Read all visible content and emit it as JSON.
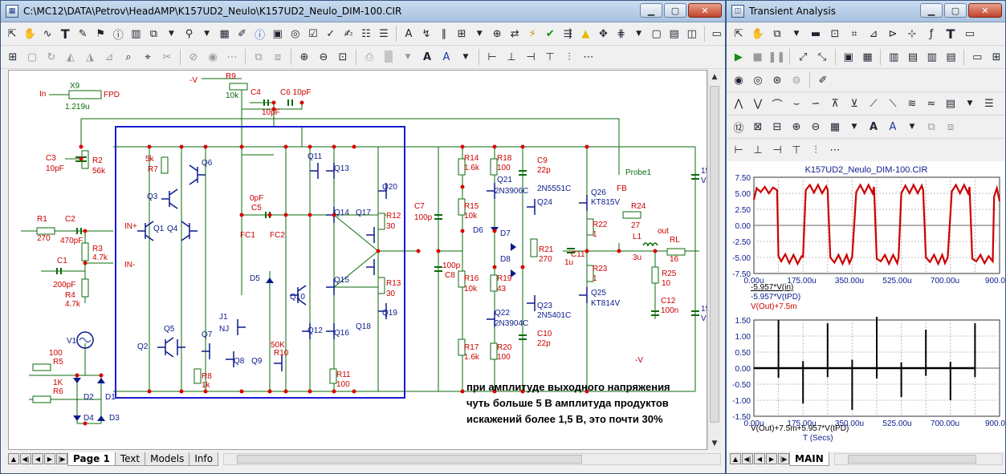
{
  "main_window": {
    "title": "C:\\MC12\\DATA\\Petrov\\HeadAMP\\K157UD2_Neulo\\K157UD2_Neulo_DIM-100.CIR",
    "tabs": [
      "Page 1",
      "Text",
      "Models",
      "Info"
    ]
  },
  "ta_window": {
    "title": "Transient Analysis",
    "tabs": [
      "MAIN"
    ]
  },
  "schematic": {
    "components": {
      "X9": "X9",
      "X9_value": "1.219u",
      "in_label": "In",
      "fpd": "FPD",
      "R9": "R9",
      "R9_value": "10k",
      "vneg": "-V",
      "C4": "C4",
      "C6": "C6 10pF",
      "C4_value": "10pF",
      "C3": "C3",
      "C3_value": "10pF",
      "R2": "R2",
      "R2_value": "56k",
      "R7_value": "5k",
      "R7": "R7",
      "Q6": "Q6",
      "Q3": "Q3",
      "R1": "R1",
      "R1_value": "270",
      "C2": "C2",
      "C2_value": "470pF",
      "INp": "IN+",
      "INm": "IN-",
      "Q1": "Q1",
      "Q4": "Q4",
      "R3": "R3",
      "R3_value": "4.7k",
      "C1": "C1",
      "C1_value": "200pF",
      "R4": "R4",
      "R4_value": "4.7k",
      "V1": "V1",
      "R5_value": "100",
      "R5": "R5",
      "R6_value": "1K",
      "R6": "R6",
      "D2": "D2",
      "D1": "D1",
      "D4": "D4",
      "D3": "D3",
      "Q5": "Q5",
      "Q2": "Q2",
      "Q7": "Q7",
      "Q8": "Q8",
      "R8": "R8",
      "R8_value": "1k",
      "C5_value": "0pF",
      "C5": "C5",
      "FC1": "FC1",
      "FC2": "FC2",
      "D5": "D5",
      "J1": "J1",
      "NJ": "NJ",
      "Q9": "Q9",
      "R10_value": "50K",
      "R10": "R10",
      "Q10": "Q10",
      "Q11": "Q11",
      "Q13": "Q13",
      "Q14": "Q14",
      "Q15": "Q15",
      "Q12": "Q12",
      "Q16": "Q16",
      "R11": "R11",
      "R11_value": "100",
      "Q17": "Q17",
      "Q20": "Q20",
      "R12": "R12",
      "R12_value": "30",
      "R13": "R13",
      "R13_value": "30",
      "Q18": "Q18",
      "Q19": "Q19",
      "R14": "R14",
      "R14_value": "1.6k",
      "R18": "R18",
      "R18_value": "100",
      "C9": "C9",
      "C9_value": "22p",
      "Q21": "Q21",
      "Q21_type": "2N3906C",
      "Q24": "Q24",
      "Q24_type": "2N5551C",
      "Q26": "Q26",
      "Q26_type": "KT815V",
      "probe": "Probe1",
      "FB": "FB",
      "C7": "C7",
      "C7_value": "100p",
      "R15": "R15",
      "R15_value": "10k",
      "D6": "D6",
      "D7": "D7",
      "D8": "D8",
      "R21": "R21",
      "R21_value": "270",
      "C11": "C11",
      "C11_value": "1u",
      "R22": "R22",
      "R22_value": "1",
      "R24": "R24",
      "R24_value": "27",
      "L1": "L1",
      "L1_value": "3u",
      "out": "out",
      "RL": "RL",
      "RL_value": "16",
      "C8_value": "100p",
      "C8": "C8",
      "R16": "R16",
      "R16_value": "10k",
      "R19": "R19",
      "R19_value": "43",
      "R23": "R23",
      "R23_value": "1",
      "R25": "R25",
      "R25_value": "10",
      "Q25": "Q25",
      "Q25_type": "KT814V",
      "Q22": "Q22",
      "Q22_type": "2N3904C",
      "Q23": "Q23",
      "Q23_type": "2N5401C",
      "C12": "C12",
      "C12_value": "100n",
      "R17": "R17",
      "R17_value": "1.6k",
      "R20": "R20",
      "R20_value": "100",
      "C10": "C10",
      "C10_value": "22p",
      "vneg2": "-V",
      "V2": "15",
      "V2_name": "V2",
      "V3": "15",
      "V3_name": "V3"
    },
    "annotation": [
      "при амплитуде выходного напряжения",
      "чуть больше 5 В амплитуда продуктов",
      "искажений более 1,5 В, это почти 30%"
    ]
  },
  "chart_data": [
    {
      "type": "line",
      "title": "K157UD2_Neulo_DIM-100.CIR",
      "x_ticks": [
        "0.00u",
        "175.00u",
        "350.00u",
        "525.00u",
        "700.00u",
        "900.00u"
      ],
      "y_ticks": [
        "7.50",
        "5.00",
        "2.50",
        "0.00",
        "-2.50",
        "-5.00",
        "-7.50"
      ],
      "ylim": [
        -7.5,
        7.5
      ],
      "xlim": [
        0,
        900
      ],
      "legend": [
        "-5.957*V(in)",
        "-5.957*V(tPD)",
        "V(Out)+7.5m"
      ],
      "series": [
        {
          "name": "V(Out)+7.5m",
          "color": "#cc0000",
          "x": [
            0,
            10,
            25,
            40,
            55,
            70,
            85,
            90,
            100,
            115,
            130,
            145,
            160,
            175,
            180,
            190,
            205,
            220,
            235,
            250,
            265,
            270,
            280,
            295,
            310,
            325,
            340,
            350,
            360,
            375,
            390,
            405,
            420,
            435,
            440,
            450,
            465,
            480,
            495,
            510,
            525,
            530,
            540,
            555,
            570,
            585,
            600,
            615,
            620,
            630,
            645,
            660,
            675,
            690,
            700,
            710,
            725,
            740,
            755,
            770,
            785,
            790,
            800,
            815,
            830,
            845,
            860,
            875,
            880,
            890,
            900
          ],
          "y": [
            4.0,
            5.8,
            5.2,
            6.0,
            5.0,
            5.9,
            5.5,
            -4.8,
            -5.6,
            -4.5,
            -5.9,
            -4.6,
            -6.0,
            -4.8,
            -4.9,
            5.5,
            6.3,
            5.1,
            6.3,
            5.0,
            6.1,
            5.6,
            -5.0,
            -5.8,
            -4.6,
            -6.0,
            -4.6,
            -5.9,
            -4.9,
            5.2,
            6.3,
            5.0,
            6.3,
            5.0,
            6.0,
            -5.2,
            -5.6,
            -4.6,
            -6.0,
            -4.6,
            -5.9,
            -5.0,
            5.0,
            6.2,
            5.0,
            6.3,
            5.0,
            6.2,
            5.5,
            -5.0,
            -5.7,
            -4.6,
            -6.0,
            -4.6,
            -5.9,
            -5.0,
            5.3,
            6.3,
            5.0,
            6.3,
            5.0,
            6.0,
            -5.2,
            -5.6,
            -4.6,
            -5.9,
            -4.8,
            -5.6,
            4.5,
            5.8,
            3.8
          ]
        }
      ]
    },
    {
      "type": "line",
      "x_ticks": [
        "0.00u",
        "175.00u",
        "350.00u",
        "525.00u",
        "700.00u",
        "900.00u"
      ],
      "y_ticks": [
        "1.50",
        "1.00",
        "0.50",
        "0.00",
        "-0.50",
        "-1.00",
        "-1.50"
      ],
      "ylim": [
        -1.5,
        1.5
      ],
      "xlim": [
        0,
        900
      ],
      "xlabel": "T (Secs)",
      "legend": [
        "V(Out)+7.5m+5.957*V(tPD)"
      ],
      "series": [
        {
          "name": "V(Out)+7.5m+5.957*V(tPD)",
          "color": "#000000",
          "spikes_x": [
            90,
            180,
            270,
            360,
            450,
            540,
            630,
            720,
            810
          ],
          "spikes_amp": [
            1.5,
            -1.1,
            1.4,
            -1.3,
            1.6,
            -0.9,
            1.2,
            -1.0,
            1.4
          ],
          "baseline": 0.0
        }
      ]
    }
  ]
}
